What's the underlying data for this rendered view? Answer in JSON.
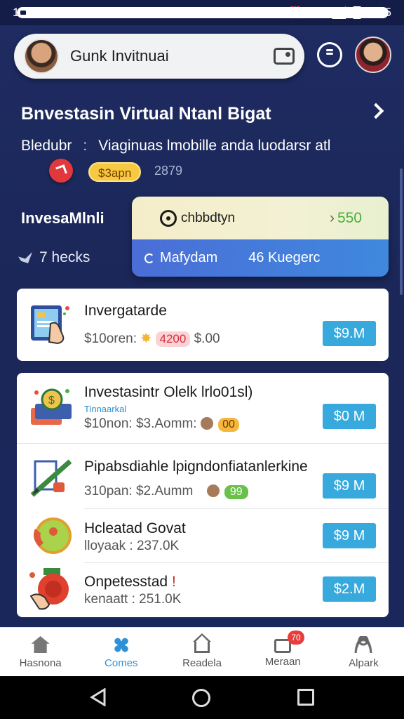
{
  "status_bar": {
    "time_left": "18:39",
    "time_right": "8:25"
  },
  "search": {
    "text": "Gunk Invitnuai"
  },
  "header": {
    "title": "Bnvestasin Virtual Ntanl Bigat",
    "sub_label": "Bledubr",
    "separator": ":",
    "sub_desc": "Viaginuas lmobille anda luodarsr atl",
    "pill_label": "$3apn",
    "count": "2879"
  },
  "stats": {
    "label": "InvesaMlnli",
    "checks": "7 hecks",
    "top_label": "chbbdtyn",
    "top_value": "550",
    "bottom_left": "Mafydam",
    "bottom_right": "46 Kuegerc"
  },
  "cards": [
    {
      "title": "Invergatarde",
      "sub": "$10oren:",
      "badge": "4200",
      "extra": "$.00",
      "value": "$9.M",
      "icon": "tablet-hand-icon"
    },
    {
      "title": "Investasintr Olelk lrlo01sl)",
      "tag": "Tinnaarkal",
      "sub": "$10non: $3.Aomm:",
      "badge": "00",
      "value": "$0 M",
      "icon": "money-box-icon"
    },
    {
      "title": "Pipabsdiahle lpigndonfiatanlerkine",
      "sub": "310pan: $2.Aumm",
      "badge": "99",
      "value": "$9 M",
      "icon": "pencil-tools-icon"
    },
    {
      "title": "Hcleatad Govat",
      "sub": "lloyaak : 237.0K",
      "value": "$9 M",
      "icon": "globe-phone-icon"
    },
    {
      "title": "Onpetesstad",
      "sub": "kenaatt : 251.0K",
      "value": "$2.M",
      "icon": "hand-coin-icon"
    }
  ],
  "nav": {
    "items": [
      "Hasnona",
      "Comes",
      "Readela",
      "Meraan",
      "Alpark"
    ],
    "active_index": 1,
    "badge": "70"
  },
  "colors": {
    "background": "#1d2a5e",
    "accent": "#37a9dd",
    "stats_value": "#4caf3a",
    "badge_red": "#e83d3d"
  }
}
